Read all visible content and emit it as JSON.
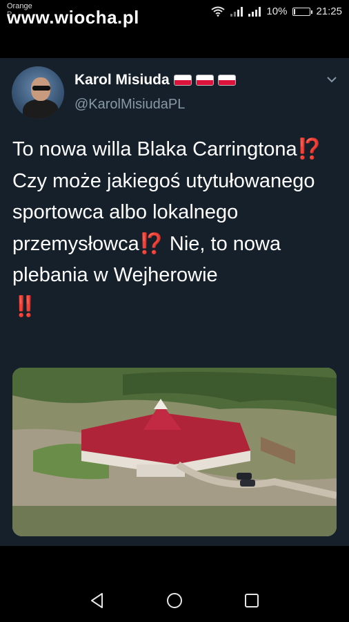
{
  "status_bar": {
    "carrier_line1": "Orange",
    "carrier_line2": "P",
    "watermark": "www.wiocha.pl",
    "battery_percent": "10%",
    "battery_level": 0.1,
    "time": "21:25"
  },
  "tweet": {
    "author_name": "Karol Misiuda",
    "flags": [
      "poland-flag",
      "poland-flag",
      "poland-flag"
    ],
    "handle": "@KarolMisiudaPL",
    "text": {
      "p1": "To nowa willa Blaka Carringtona",
      "e1": "⁉️",
      "p2": " Czy może jakiegoś utytułowanego sportowca albo lokalnego przemysłowca",
      "e2": "⁉️",
      "p3": " Nie, to nowa plebania w Wejherowie ",
      "e3": "‼️"
    },
    "image_icon": "aerial-villa-photo"
  },
  "icons": {
    "menu": "chevron-down-icon",
    "back": "back-triangle-icon",
    "home": "home-circle-icon",
    "recents": "recents-square-icon"
  },
  "colors": {
    "card_bg": "#15202b",
    "handle": "#8899a6",
    "emoji_red": "#e53935",
    "flag_red": "#dc143c"
  }
}
